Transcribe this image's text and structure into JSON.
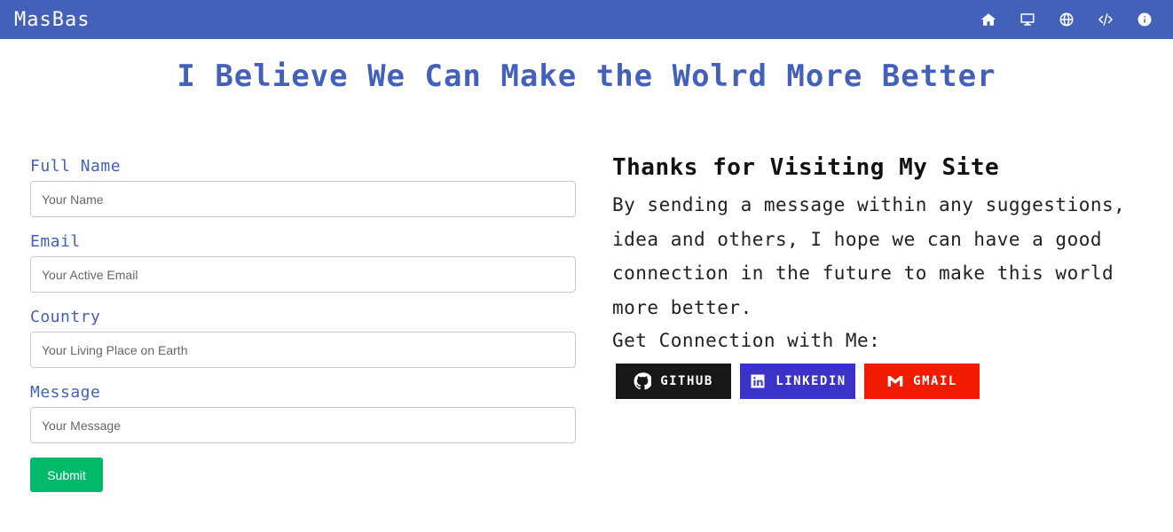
{
  "navbar": {
    "brand": "MasBas",
    "icons": [
      "home-icon",
      "desktop-icon",
      "globe-icon",
      "code-icon",
      "info-icon"
    ]
  },
  "headline": "I Believe We Can Make the Wolrd More Better",
  "form": {
    "name_label": "Full Name",
    "name_placeholder": "Your Name",
    "email_label": "Email",
    "email_placeholder": "Your Active Email",
    "country_label": "Country",
    "country_placeholder": "Your Living Place on Earth",
    "message_label": "Message",
    "message_placeholder": "Your Message",
    "submit_label": "Submit"
  },
  "info": {
    "title": "Thanks for Visiting My Site",
    "text": "By sending a message within any suggestions, idea and others, I hope we can have a good connection in the future to make this world more better.",
    "connect_label": "Get Connection with Me:"
  },
  "socials": {
    "github": {
      "label": "GITHUB",
      "color": "#171717"
    },
    "linkedin": {
      "label": "LINKEDIN",
      "color": "#3b32c8"
    },
    "gmail": {
      "label": "GMAIL",
      "color": "#f21a00"
    }
  },
  "colors": {
    "primary": "#4361b8",
    "submit": "#00b96b"
  }
}
